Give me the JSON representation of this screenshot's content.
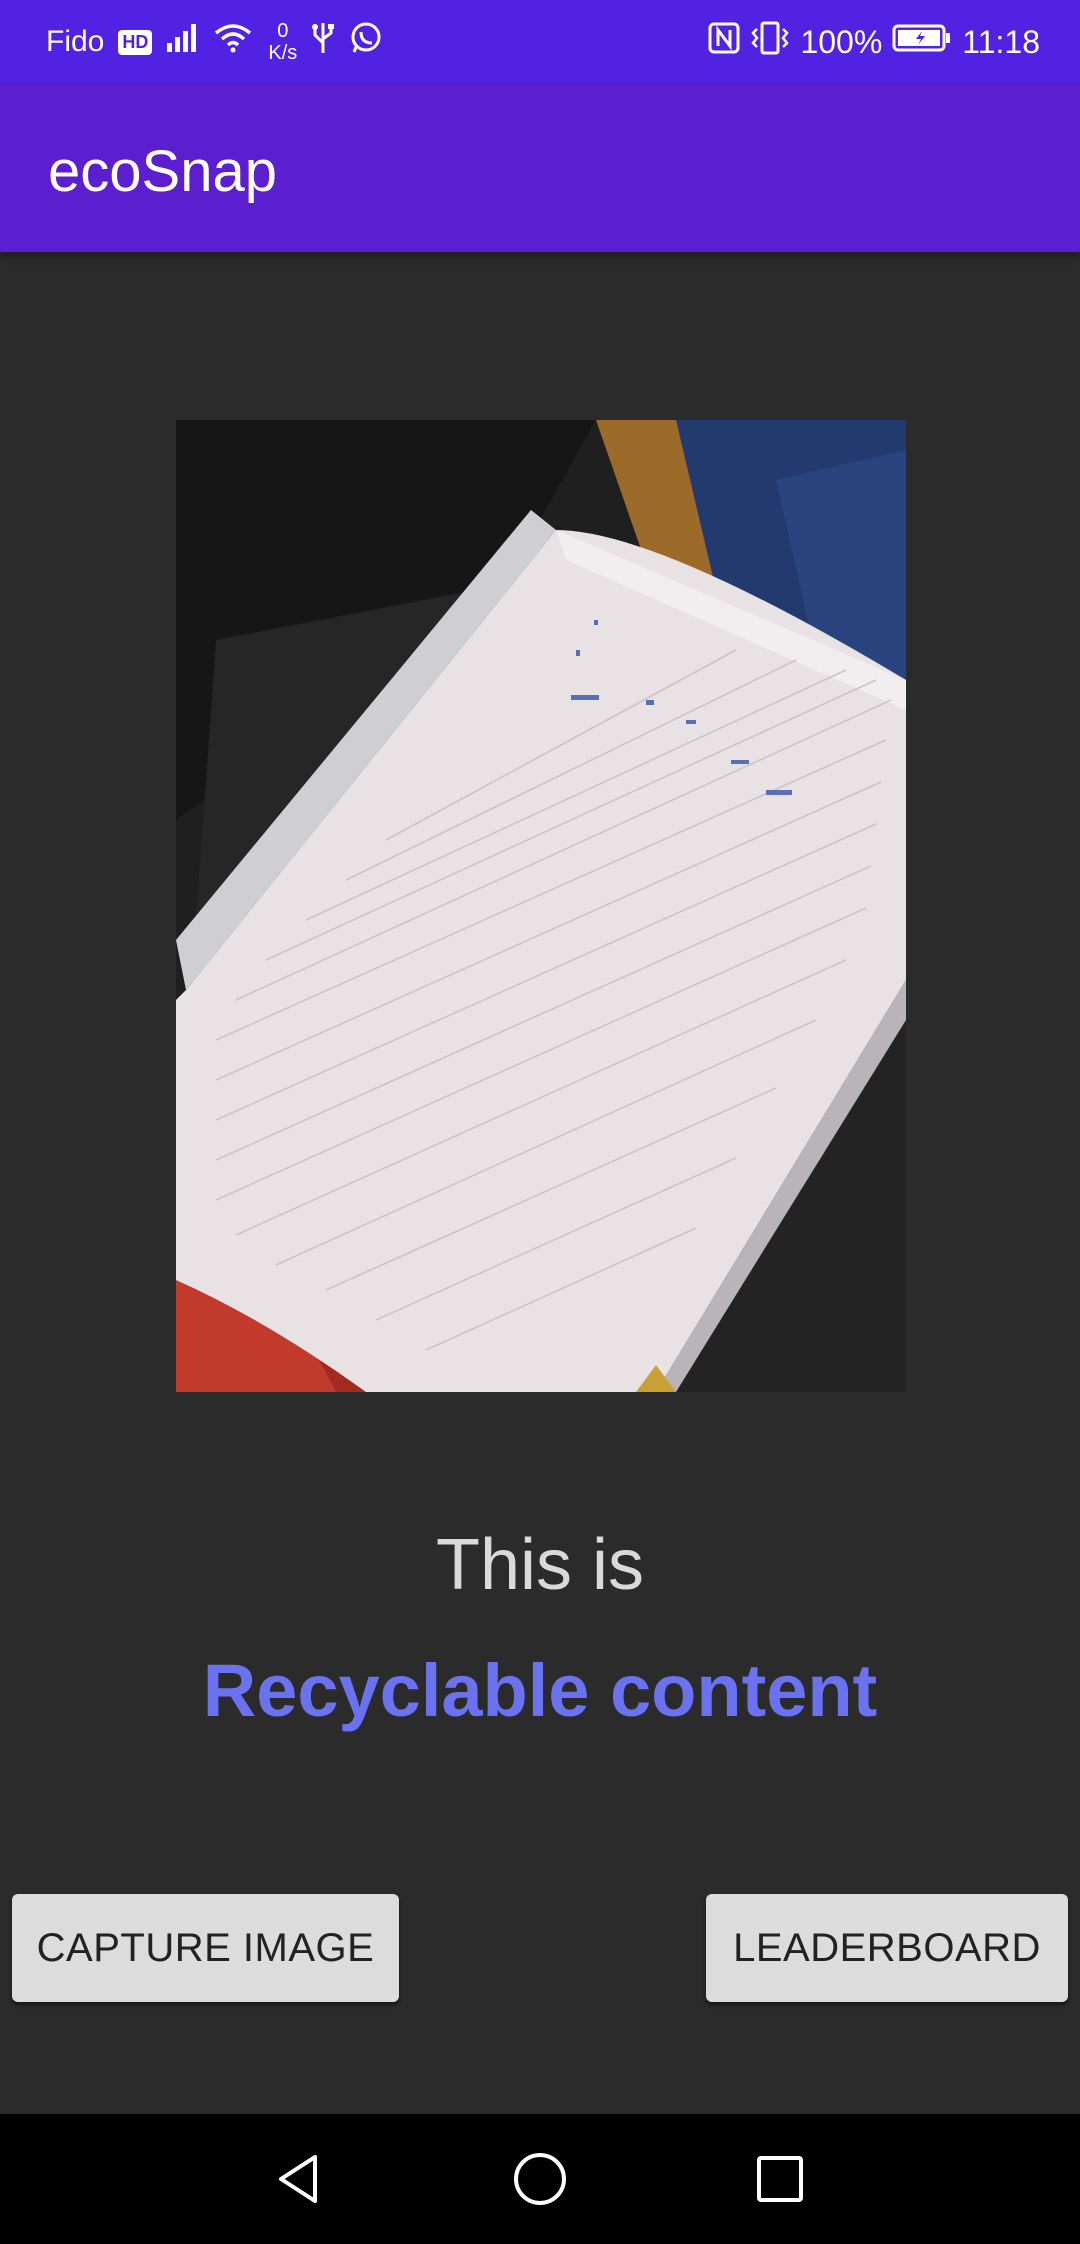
{
  "status_bar": {
    "carrier": "Fido",
    "carrier_badge": "HD",
    "speed_value": "0",
    "speed_unit": "K/s",
    "battery": "100%",
    "time": "11:18",
    "icons": [
      "signal-icon",
      "wifi-icon",
      "usb-icon",
      "whatsapp-icon",
      "nfc-icon",
      "vibrate-icon",
      "battery-icon"
    ]
  },
  "app_bar": {
    "title": "ecoSnap"
  },
  "photo": {
    "subject": "notebook-photo"
  },
  "result": {
    "prefix": "This is",
    "label": "Recyclable content"
  },
  "buttons": {
    "capture": "CAPTURE IMAGE",
    "leaderboard": "LEADERBOARD"
  },
  "colors": {
    "status_bar": "#5222e2",
    "app_bar": "#5b1fd0",
    "background": "#2b2b2b",
    "result_accent": "#6b72ef",
    "button_bg": "#dcdcdc"
  },
  "nav": {
    "icons": [
      "back-icon",
      "home-icon",
      "recents-icon"
    ]
  }
}
